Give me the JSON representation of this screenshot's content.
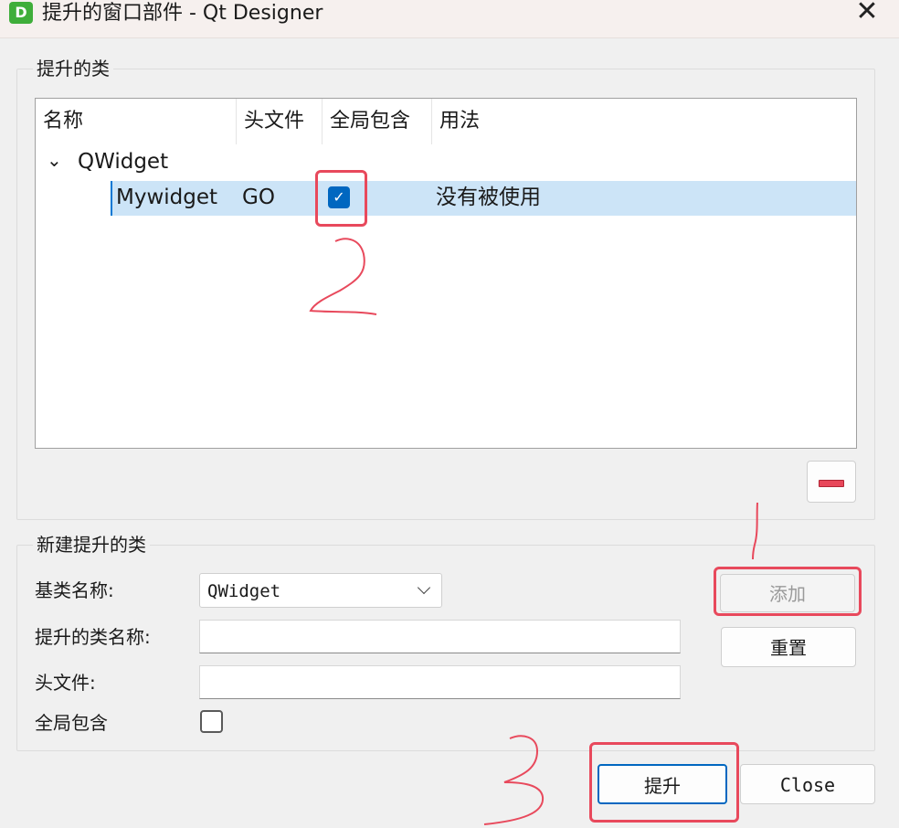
{
  "window": {
    "icon_letter": "D",
    "title": "提升的窗口部件 - Qt Designer",
    "close_glyph": "✕"
  },
  "promoted_group": {
    "title": "提升的类",
    "columns": [
      "名称",
      "头文件",
      "全局包含",
      "用法"
    ],
    "parent_node": {
      "expander": "⌄",
      "name": "QWidget"
    },
    "child_row": {
      "name": "Mywidget",
      "header": "GO",
      "global_include": true,
      "usage": "没有被使用"
    },
    "remove_button_icon": "minus-icon"
  },
  "new_group": {
    "title": "新建提升的类",
    "base_class_label": "基类名称:",
    "base_class_value": "QWidget",
    "promoted_name_label": "提升的类名称:",
    "promoted_name_value": "",
    "header_label": "头文件:",
    "header_value": "",
    "global_label": "全局包含",
    "global_checked": false,
    "add_button": "添加",
    "reset_button": "重置"
  },
  "footer": {
    "promote_button": "提升",
    "close_button": "Close"
  },
  "annotations": {
    "color": "#e8495c",
    "marks": [
      "2",
      "3"
    ]
  }
}
